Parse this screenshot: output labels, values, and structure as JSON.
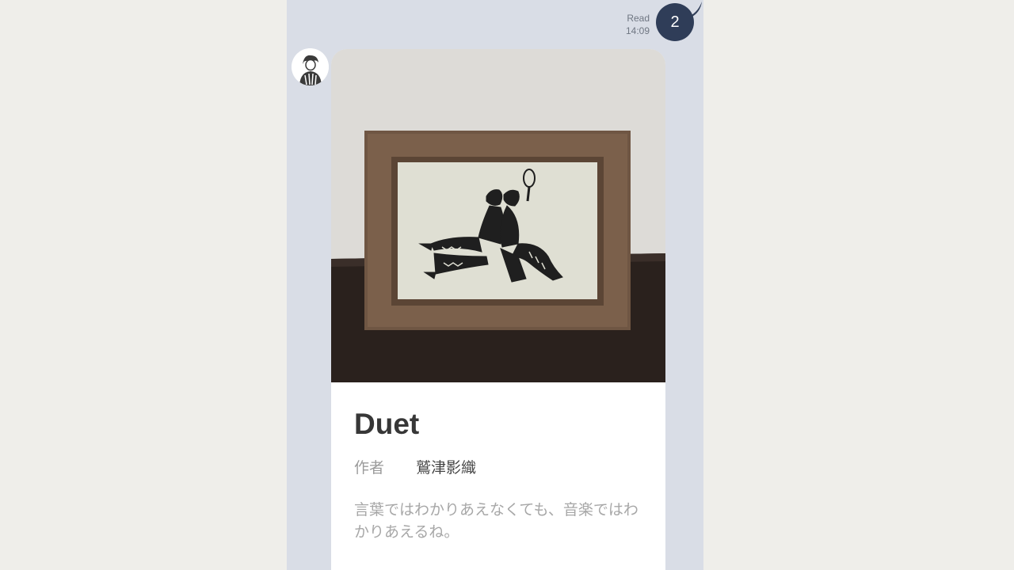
{
  "status": {
    "read_label": "Read",
    "time": "14:09"
  },
  "bubble": {
    "count": "2"
  },
  "card": {
    "title": "Duet",
    "author_label": "作者",
    "author_name": "鷲津影織",
    "description": "言葉ではわかりあえなくても、音楽ではわかりあえるね。"
  },
  "colors": {
    "background": "#efeeea",
    "chat_background": "#d9dde6",
    "bubble": "#2f3d58",
    "card": "#ffffff",
    "frame_wood": "#6e5542"
  },
  "icons": [
    "avatar-image",
    "framed-papercut-photo"
  ]
}
